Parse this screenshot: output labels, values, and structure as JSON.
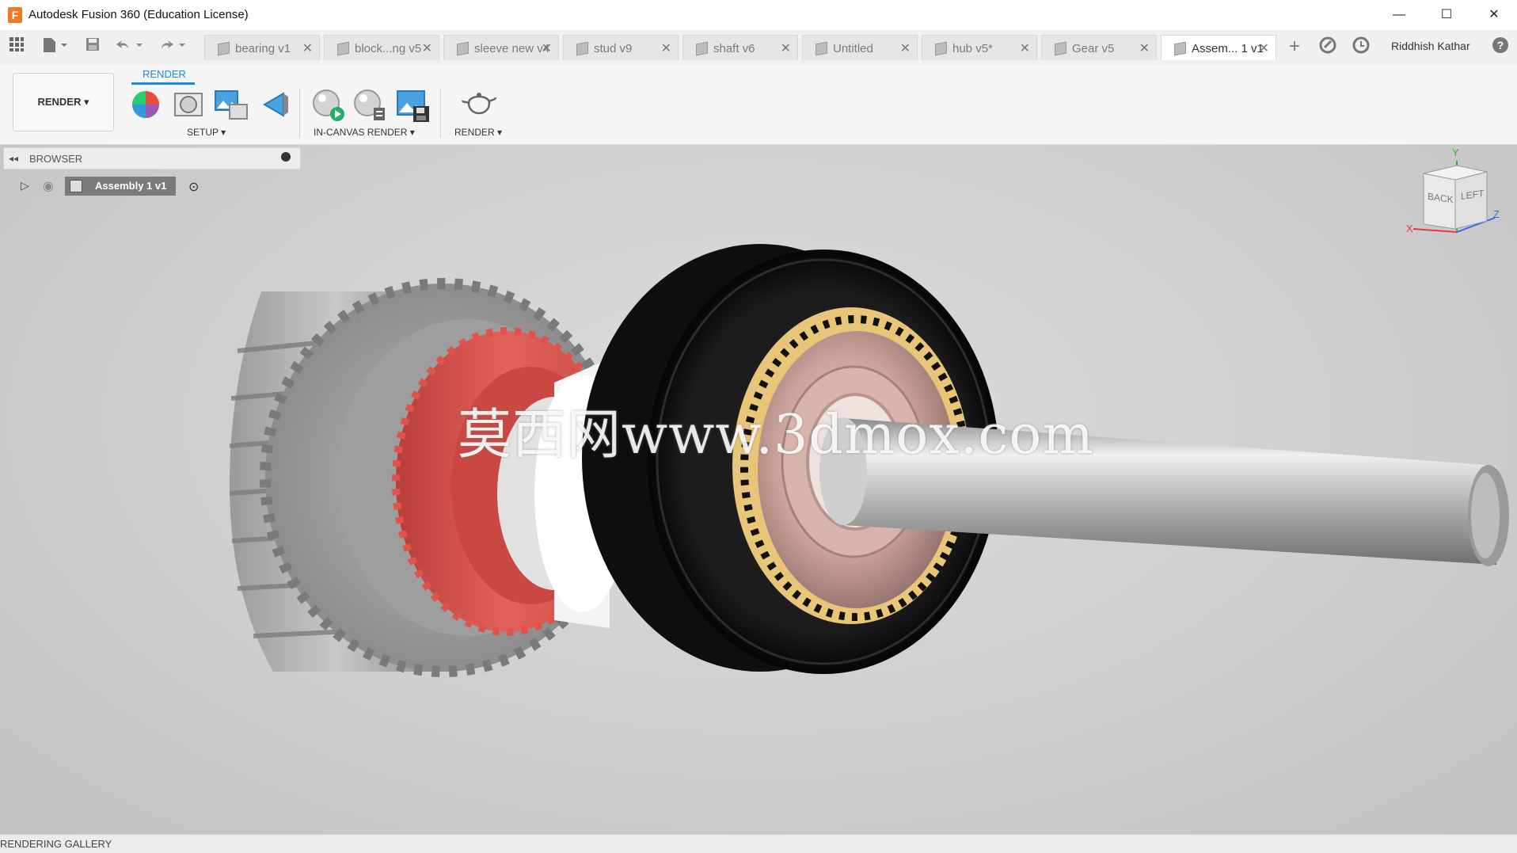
{
  "app": {
    "logo_letter": "F",
    "title": "Autodesk Fusion 360 (Education License)",
    "window_controls": [
      "—",
      "☐",
      "✕"
    ]
  },
  "tabs": [
    {
      "label": "bearing v1",
      "active": false
    },
    {
      "label": "block...ng v5",
      "active": false
    },
    {
      "label": "sleeve new v4",
      "active": false
    },
    {
      "label": "stud v9",
      "active": false
    },
    {
      "label": "shaft v6",
      "active": false
    },
    {
      "label": "Untitled",
      "active": false
    },
    {
      "label": "hub v5*",
      "active": false
    },
    {
      "label": "Gear v5",
      "active": false
    },
    {
      "label": "Assem... 1 v1",
      "active": true
    }
  ],
  "tab_close_glyph": "✕",
  "user": {
    "name": "Riddhish Kathar"
  },
  "toolbar": {
    "workspace_label": "RENDER ▾",
    "active_tab": "RENDER",
    "groups": {
      "setup": "SETUP ▾",
      "in_canvas": "IN-CANVAS RENDER ▾",
      "render": "RENDER ▾"
    }
  },
  "browser": {
    "title": "BROWSER",
    "root_item": "Assembly 1 v1"
  },
  "viewcube": {
    "back": "BACK",
    "left": "LEFT",
    "axis_x": "X",
    "axis_y": "Y",
    "axis_z": "Z"
  },
  "watermark": "莫西网www.3dmox.com",
  "status": {
    "panel": "RENDERING GALLERY"
  },
  "colors": {
    "accent": "#1d8ad8",
    "gear": "#a9a9a9",
    "red_part": "#e35a55",
    "tire": "#111111",
    "gold": "#e9c77c",
    "hub": "#d9b6ad",
    "shaft": "#bdbdbd"
  }
}
